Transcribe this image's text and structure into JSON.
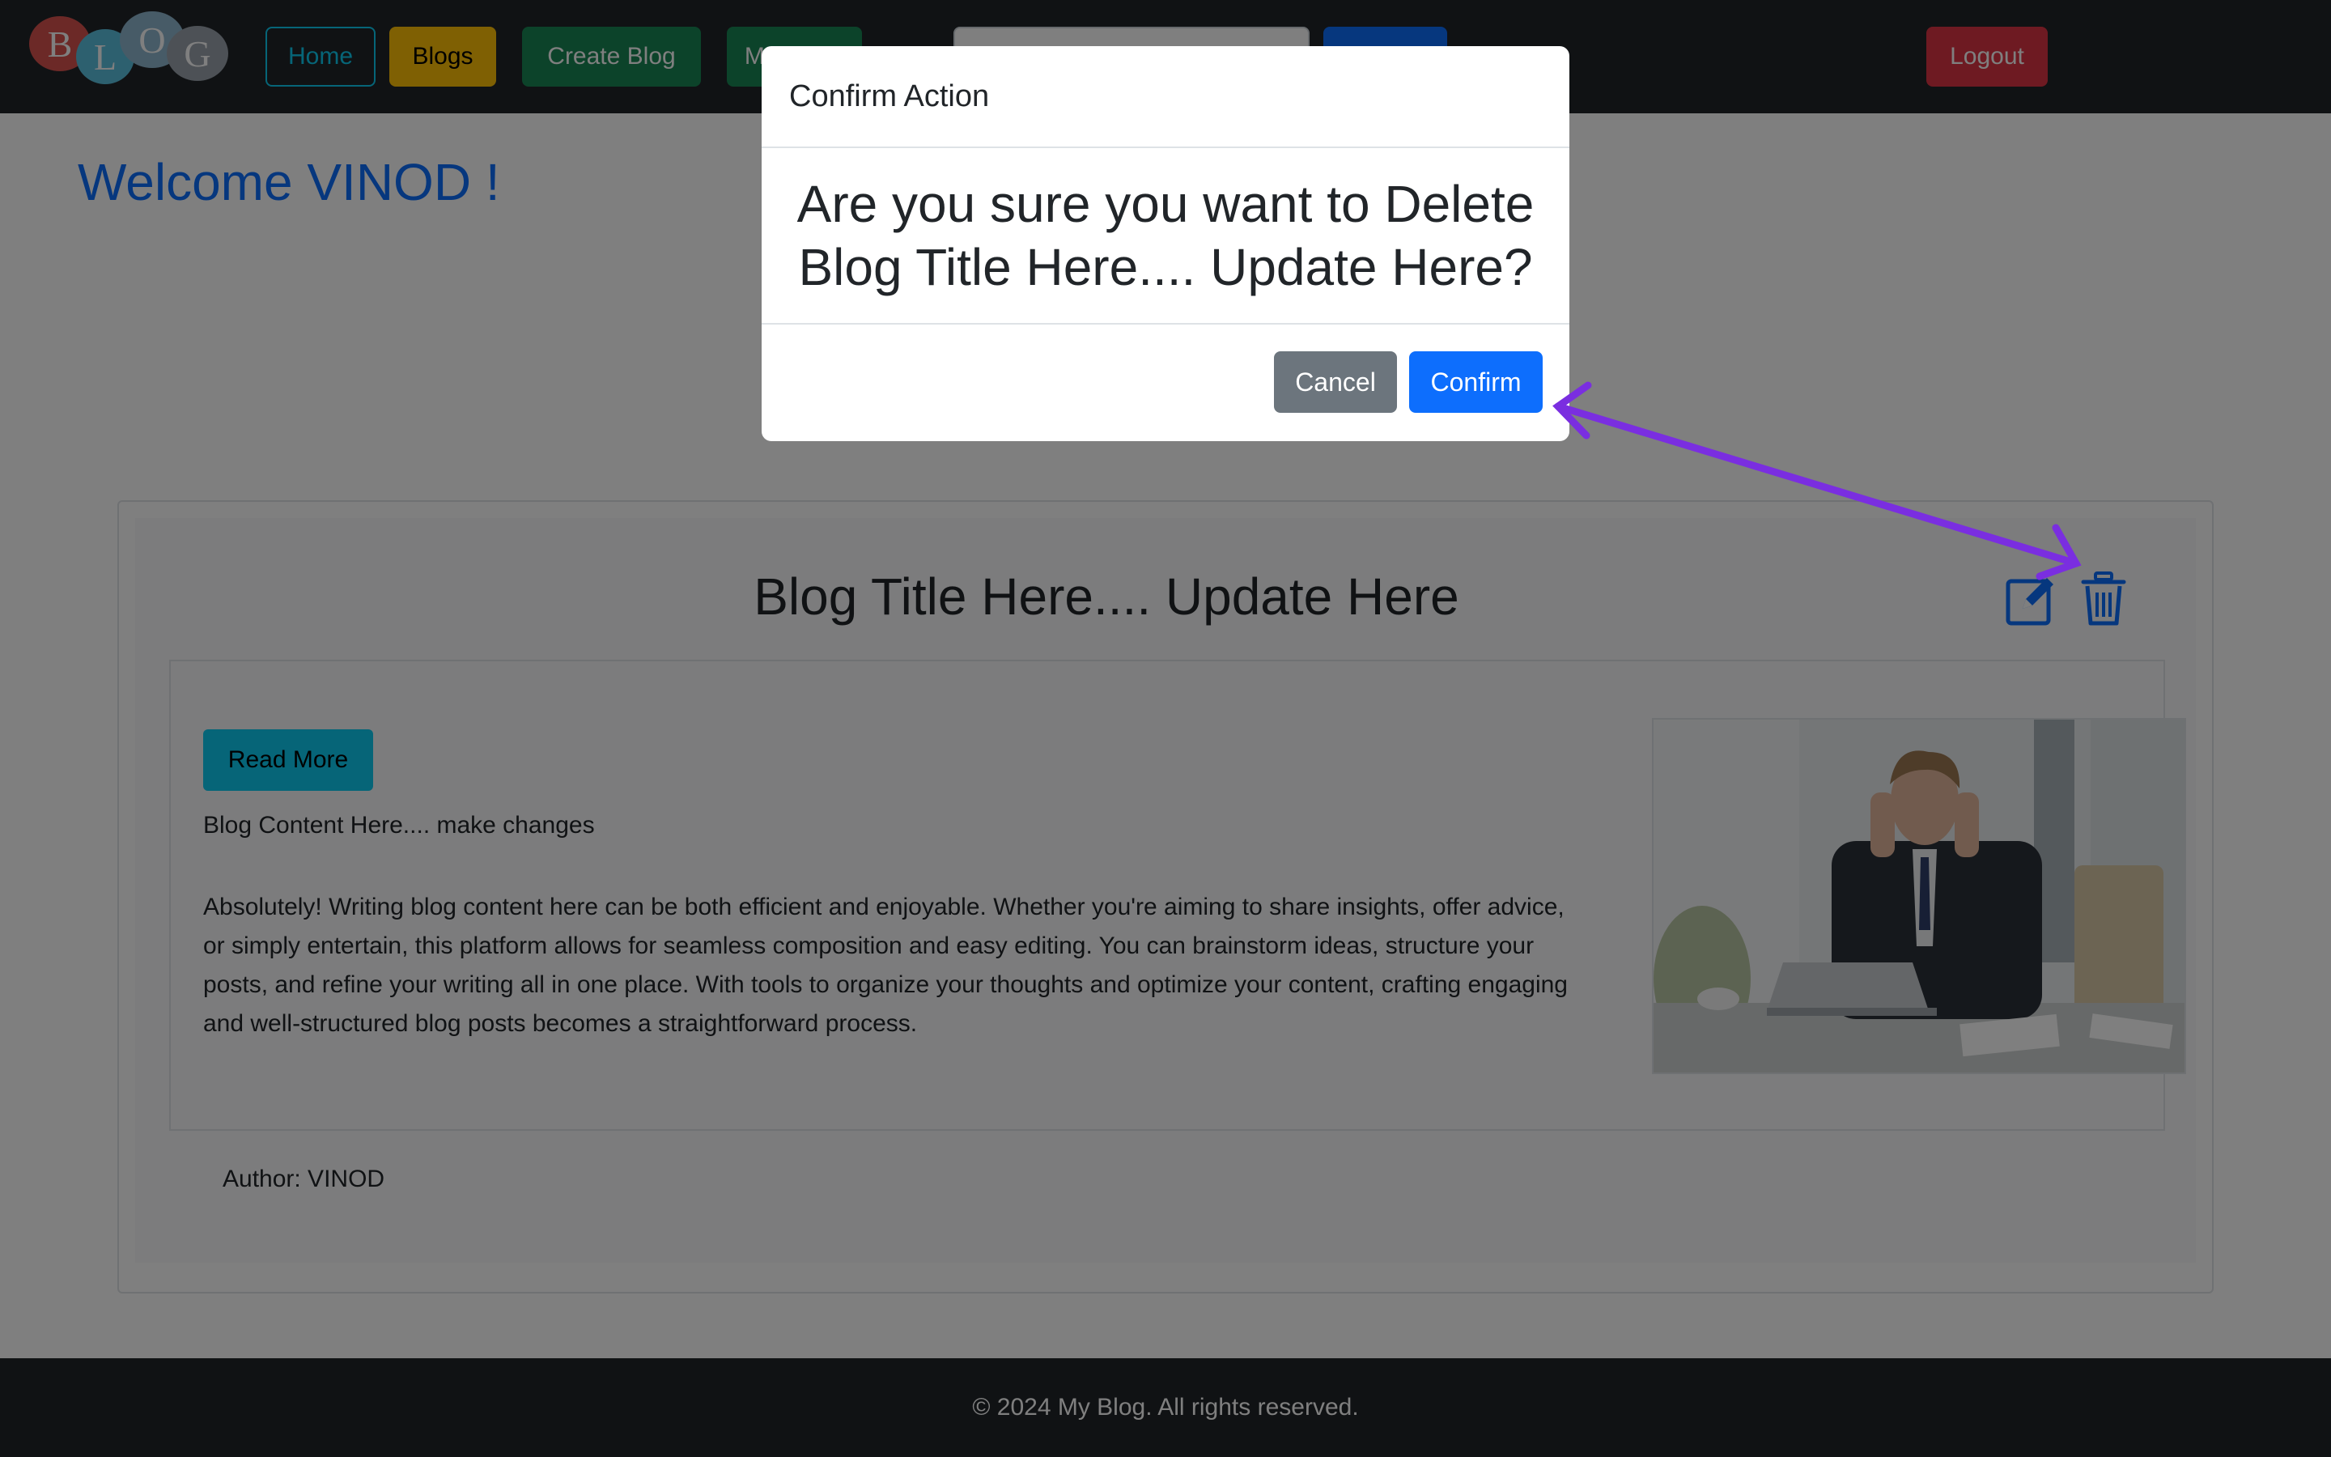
{
  "navbar": {
    "logo_letters": [
      "B",
      "L",
      "O",
      "G"
    ],
    "home": "Home",
    "blogs": "Blogs",
    "create_blog": "Create Blog",
    "my_blogs": "My Blogs",
    "search_placeholder": "",
    "search_button": "",
    "logout": "Logout"
  },
  "main": {
    "welcome": "Welcome VINOD !",
    "blog": {
      "title": "Blog Title Here.... Update Here",
      "read_more": "Read More",
      "content_heading": "Blog Content Here.... make changes",
      "content_body": "Absolutely! Writing blog content here can be both efficient and enjoyable. Whether you're aiming to share insights, offer advice, or simply entertain, this platform allows for seamless composition and easy editing. You can brainstorm ideas, structure your posts, and refine your writing all in one place. With tools to organize your thoughts and optimize your content, crafting engaging and well-structured blog posts becomes a straightforward process.",
      "author": "Author: VINOD",
      "icons": [
        "edit-icon",
        "trash-icon"
      ]
    }
  },
  "footer": {
    "text": "© 2024 My Blog. All rights reserved."
  },
  "modal": {
    "title": "Confirm Action",
    "message": "Are you sure you want to Delete Blog Title Here.... Update Here?",
    "cancel": "Cancel",
    "confirm": "Confirm"
  },
  "colors": {
    "navbar_bg": "#212529",
    "primary": "#0d6efd",
    "info": "#0dcaf0",
    "warning": "#ffc107",
    "success": "#198754",
    "danger": "#dc3545",
    "secondary": "#6c757d",
    "annotation_arrow": "#7a2ee0"
  }
}
